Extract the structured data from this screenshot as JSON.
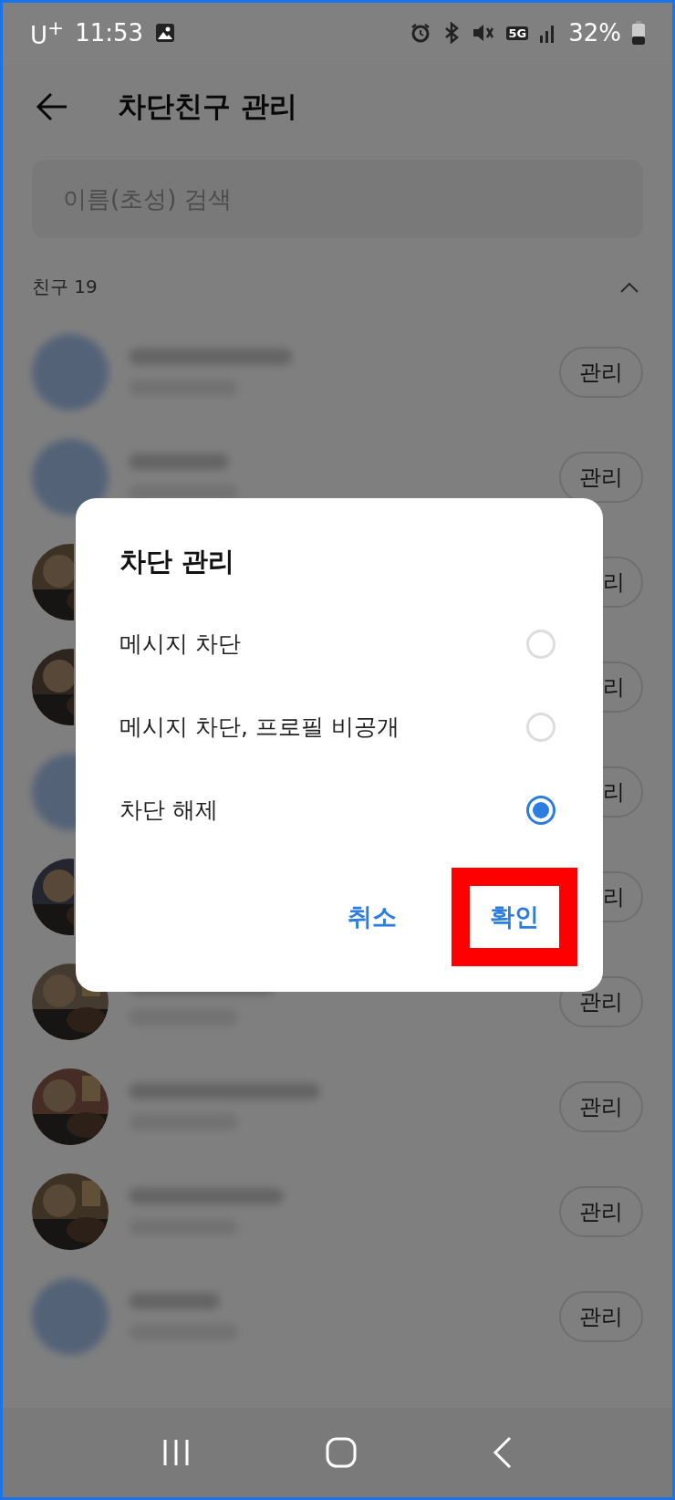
{
  "status_bar": {
    "carrier": "U$^{+}$",
    "time": "11:53",
    "network": "5G",
    "battery": "32%"
  },
  "header": {
    "title": "차단친구 관리"
  },
  "search": {
    "placeholder": "이름(초성) 검색"
  },
  "section": {
    "label": "친구 19",
    "expanded": true
  },
  "friends": [
    {
      "kind": "plain",
      "button": "관리"
    },
    {
      "kind": "plain",
      "button": "관리"
    },
    {
      "kind": "picture",
      "button": "리"
    },
    {
      "kind": "picture",
      "button": "리"
    },
    {
      "kind": "plain",
      "button": "리"
    },
    {
      "kind": "picture",
      "button": "리"
    },
    {
      "kind": "picture",
      "button": "관리"
    },
    {
      "kind": "picture",
      "button": "관리"
    },
    {
      "kind": "picture",
      "button": "관리"
    },
    {
      "kind": "plain",
      "button": "관리"
    }
  ],
  "dialog": {
    "title": "차단 관리",
    "options": [
      {
        "label": "메시지 차단",
        "selected": false
      },
      {
        "label": "메시지 차단, 프로필 비공개",
        "selected": false
      },
      {
        "label": "차단 해제",
        "selected": true
      }
    ],
    "buttons": [
      {
        "label": "취소",
        "highlighted": false
      },
      {
        "label": "확인",
        "highlighted": true
      }
    ]
  }
}
